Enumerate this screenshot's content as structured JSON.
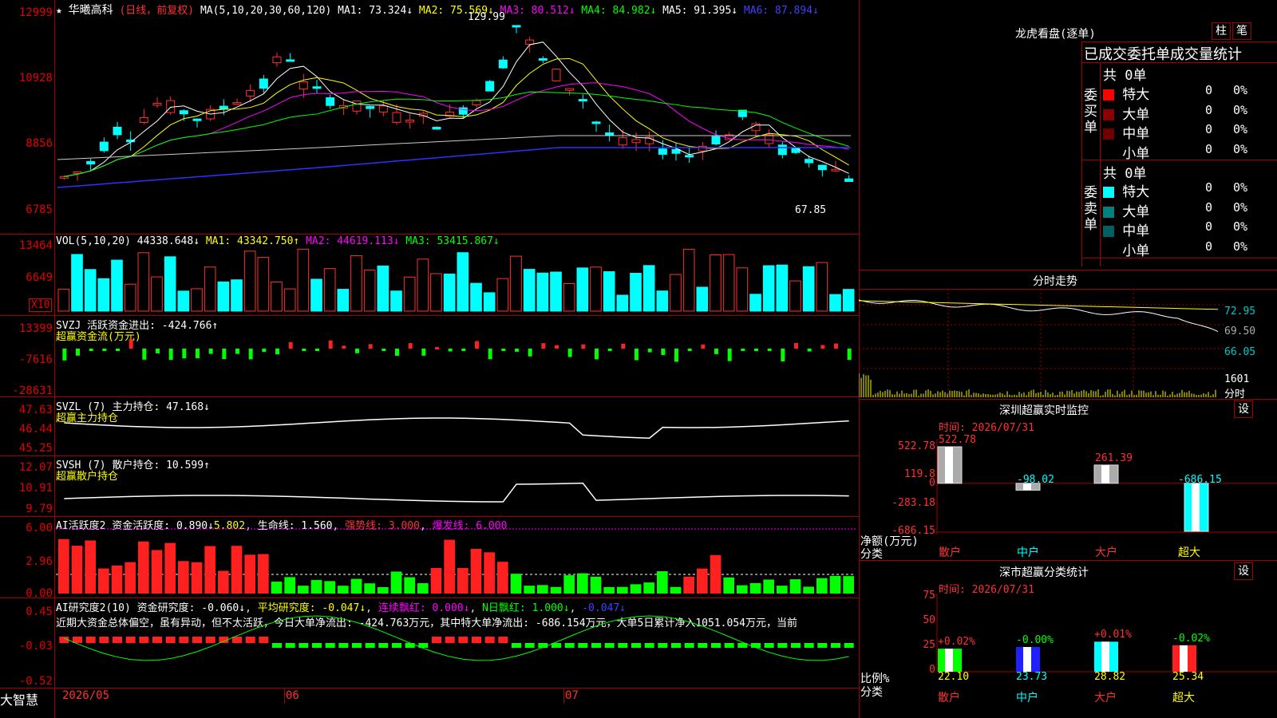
{
  "stock": {
    "name": "华曦高科",
    "mode": "(日线，前复权)",
    "star_icon": "★"
  },
  "ma_header": {
    "label": "MA(5,10,20,30,60,120)",
    "ma1": "MA1: 73.324↓",
    "ma2": "MA2: 75.569↓",
    "ma3": "MA3: 80.512↓",
    "ma4": "MA4: 84.982↓",
    "ma5": "MA5: 91.395↓",
    "ma6": "MA6: 87.894↓"
  },
  "price_axis": [
    "12999",
    "10928",
    "8856",
    "6785"
  ],
  "price_annotations": {
    "high": "129.99",
    "low": "67.85"
  },
  "vol_header": {
    "label": "VOL(5,10,20)",
    "value": "44338.648↓",
    "ma1": "MA1: 43342.750↑",
    "ma2": "MA2: 44619.113↓",
    "ma3": "MA3: 53415.867↓"
  },
  "vol_axis": [
    "13464",
    "6649"
  ],
  "vol_unit": "X10",
  "svzj": {
    "label": "SVZJ 活跃资金进出: -424.766↑",
    "sub": "超赢资金流(万元)",
    "axis": [
      "13399",
      "-7616",
      "-28631"
    ]
  },
  "svzl": {
    "label": "SVZL (7) 主力持仓: 47.168↓",
    "sub": "超赢主力持仓",
    "axis": [
      "47.63",
      "46.44",
      "45.25"
    ]
  },
  "svsh": {
    "label": "SVSH (7) 散户持仓: 10.599↑",
    "sub": "超赢散户持仓",
    "axis": [
      "12.07",
      "10.91",
      "9.79"
    ]
  },
  "ai1": {
    "label": "AI活跃度2 资金活跃度: 0.890↓",
    "v2": "5.802",
    "life": "生命线: 1.560",
    "strong": "强势线: 3.000",
    "burst": "爆发线: 6.000",
    "axis": [
      "6.00",
      "2.96",
      "0.00"
    ]
  },
  "ai2": {
    "label": "AI研究度2(10) 资金研究度: -0.060↓",
    "avg": "平均研究度: -0.047↓",
    "cont": "连续飘红: 0.000↓",
    "nday": "N日飘红: 1.000↓",
    "last": "-0.047↓",
    "note": "近期大资金总体偏空，虽有异动，但不太活跃，今日大单净流出: -424.763万元，其中特大单净流出: -686.154万元，大单5日累计净入1051.054万元，当前",
    "axis": [
      "0.45",
      "-0.03",
      "-0.52"
    ]
  },
  "time_axis": [
    "2026/05",
    "06",
    "07"
  ],
  "brand": "大智慧",
  "lhb": {
    "title": "龙虎看盘(逐单)",
    "btn1": "柱",
    "btn2": "笔",
    "tab": "已成交委托单成交量统计",
    "buy_label": "委买单",
    "sell_label": "委卖单",
    "buy_total": "共 0单",
    "sell_total": "共 0单",
    "rows": [
      {
        "name": "特大",
        "n": "0",
        "p": "0%"
      },
      {
        "name": "大单",
        "n": "0",
        "p": "0%"
      },
      {
        "name": "中单",
        "n": "0",
        "p": "0%"
      },
      {
        "name": "小单",
        "n": "0",
        "p": "0%"
      }
    ]
  },
  "intraday": {
    "title": "分时走势",
    "axis": [
      "72.95",
      "69.50",
      "66.05",
      "1601",
      "分时"
    ]
  },
  "monitor": {
    "title": "深圳超赢实时监控",
    "set": "设",
    "time": "时间: 2026/07/31",
    "axis": [
      "522.78",
      "119.8",
      "0",
      "-283.18",
      "-686.15"
    ],
    "unit": "净额(万元)",
    "cat": "分类",
    "values": [
      {
        "v": "522.78",
        "val": 522.78
      },
      {
        "v": "-98.02",
        "val": -98.02
      },
      {
        "v": "261.39",
        "val": 261.39
      },
      {
        "v": "-686.15",
        "val": -686.15
      }
    ],
    "labels": [
      "散户",
      "中户",
      "大户",
      "超大"
    ]
  },
  "classify": {
    "title": "深市超赢分类统计",
    "set": "设",
    "time": "时间: 2026/07/31",
    "axis": [
      "75",
      "50",
      "25",
      "0"
    ],
    "unit": "比例%",
    "cat": "分类",
    "items": [
      {
        "top": "+0.02%",
        "bottom": "22.10",
        "color": "#00ff00"
      },
      {
        "top": "-0.00%",
        "bottom": "23.73",
        "color": "#2020ff"
      },
      {
        "top": "+0.01%",
        "bottom": "28.82",
        "color": "#00ffff"
      },
      {
        "top": "-0.02%",
        "bottom": "25.34",
        "color": "#ff2020"
      }
    ],
    "labels": [
      "散户",
      "中户",
      "大户",
      "超大"
    ]
  }
}
